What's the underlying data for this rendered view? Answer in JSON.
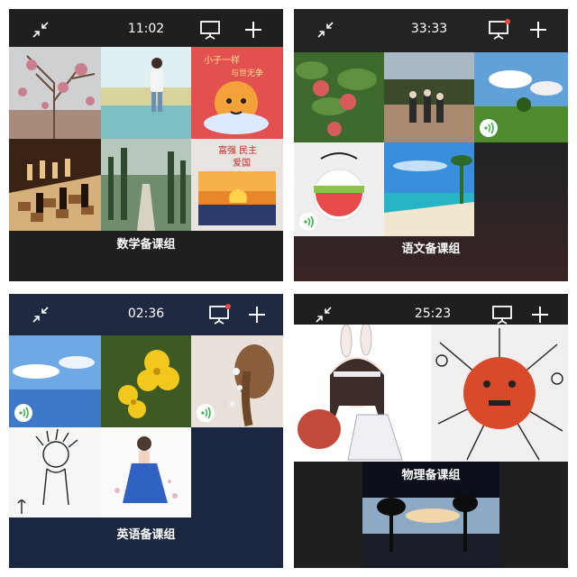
{
  "panels": [
    {
      "timer": "11:02",
      "group": "数学备课组",
      "tile_captions": [
        "小子一样",
        "与世无争",
        "富强 民主",
        "爱国"
      ]
    },
    {
      "timer": "33:33",
      "group": "语文备课组"
    },
    {
      "timer": "02:36",
      "group": "英语备课组"
    },
    {
      "timer": "25:23",
      "group": "物理备课组"
    }
  ],
  "icons": {
    "collapse": "collapse-arrows-icon",
    "screen_share": "screen-share-icon",
    "add": "plus-icon",
    "voice": "voice-wave-icon",
    "notification_dot": "red-dot-icon"
  },
  "colors": {
    "accent_dot": "#e64a3b",
    "voice_green": "#3bb44a"
  }
}
